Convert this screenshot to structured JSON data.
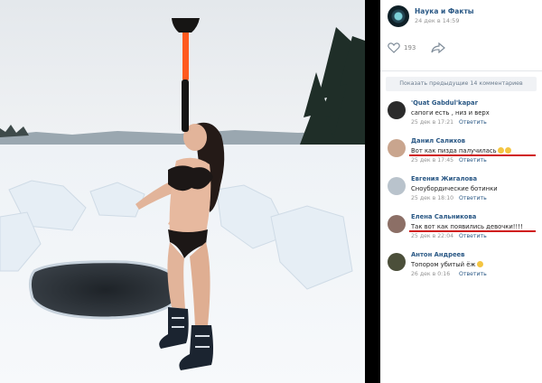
{
  "post": {
    "group_name": "Наука и Факты",
    "time": "24 дек в 14:59",
    "likes": "193",
    "show_previous": "Показать предыдущие 14 комментариев"
  },
  "comments": [
    {
      "author": "'Quat Gabdul'kapar",
      "text": "сапоги есть , низ и верх",
      "date": "25 дек в 17:21",
      "reply": "Ответить",
      "avatar_color": "#2b2b2b",
      "underline": false,
      "emoji_count": 0
    },
    {
      "author": "Данил Салихов",
      "text": "Вот как пизда палучилась",
      "date": "25 дек в 17:45",
      "reply": "Ответить",
      "avatar_color": "#c9a58e",
      "underline": true,
      "emoji_count": 2
    },
    {
      "author": "Евгения Жигалова",
      "text": "Сноубордические ботинки",
      "date": "25 дек в 18:10",
      "reply": "Ответить",
      "avatar_color": "#b9c3cc",
      "underline": false,
      "emoji_count": 0
    },
    {
      "author": "Елена Сальникова",
      "text": "Так вот как появились девочки!!!!",
      "date": "25 дек в 22:04",
      "reply": "Ответить",
      "avatar_color": "#8c6f66",
      "underline": true,
      "emoji_count": 0
    },
    {
      "author": "Антон Андреев",
      "text": "Топором убитый ёж",
      "date": "26 дек в 0:16",
      "reply": "Ответить",
      "avatar_color": "#4b4f3a",
      "underline": false,
      "emoji_count": 1
    }
  ],
  "colors": {
    "link": "#2a5885",
    "underline": "#d01818",
    "axe_handle": "#ff5a1f"
  },
  "icons": {
    "like": "heart-outline-icon",
    "share": "share-arrow-icon"
  }
}
